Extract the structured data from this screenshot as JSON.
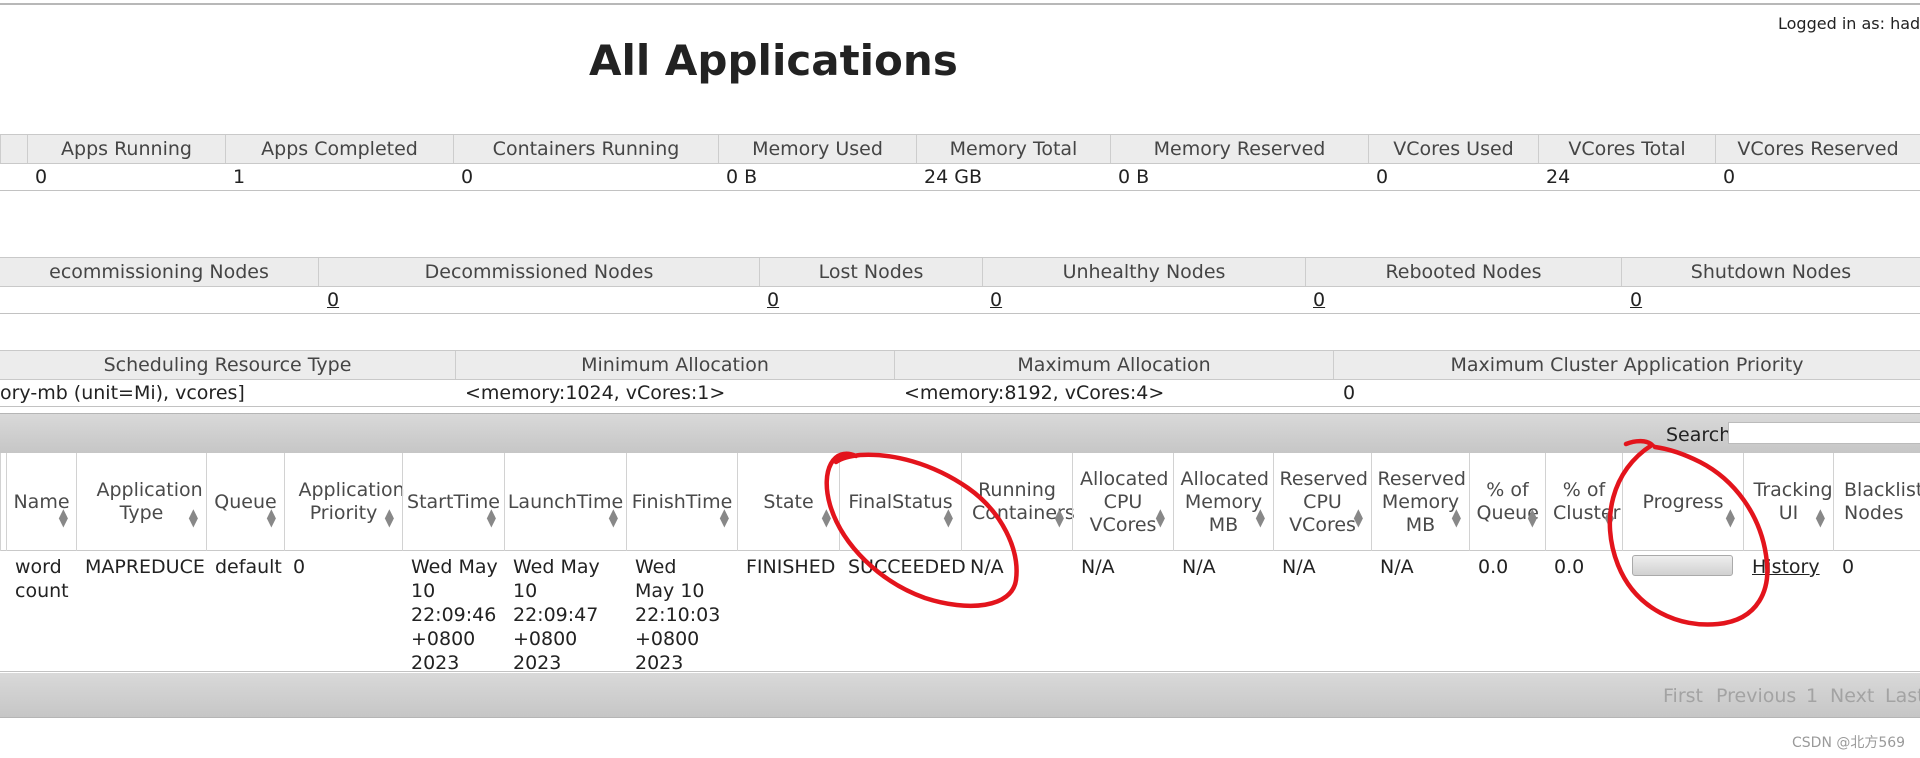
{
  "header": {
    "logged_in": "Logged in as: hadc",
    "title": "All Applications"
  },
  "metrics": {
    "headers": [
      "Apps Running",
      "Apps Completed",
      "Containers Running",
      "Memory Used",
      "Memory Total",
      "Memory Reserved",
      "VCores Used",
      "VCores Total",
      "VCores Reserved"
    ],
    "values": [
      "0",
      "1",
      "0",
      "0 B",
      "24 GB",
      "0 B",
      "0",
      "24",
      "0"
    ]
  },
  "nodes": {
    "headers": [
      "ecommissioning Nodes",
      "Decommissioned Nodes",
      "Lost Nodes",
      "Unhealthy Nodes",
      "Rebooted Nodes",
      "Shutdown Nodes"
    ],
    "values": [
      "0",
      "0",
      "0",
      "0",
      "0"
    ]
  },
  "scheduler": {
    "headers": [
      "Scheduling Resource Type",
      "Minimum Allocation",
      "Maximum Allocation",
      "Maximum Cluster Application Priority"
    ],
    "values": [
      "ory-mb (unit=Mi), vcores]",
      "<memory:1024, vCores:1>",
      "<memory:8192, vCores:4>",
      "0"
    ]
  },
  "search": {
    "label": "Search:",
    "value": ""
  },
  "apps_table": {
    "columns": [
      "Name",
      "Application Type",
      "Queue",
      "Application Priority",
      "StartTime",
      "LaunchTime",
      "FinishTime",
      "State",
      "FinalStatus",
      "Running Containers",
      "Allocated CPU VCores",
      "Allocated Memory MB",
      "Reserved CPU VCores",
      "Reserved Memory MB",
      "% of Queue",
      "% of Cluster",
      "Progress",
      "Tracking UI",
      "Blackliste Nodes"
    ],
    "row": {
      "name": "word count",
      "type": "MAPREDUCE",
      "queue": "default",
      "priority": "0",
      "start": "Wed May 10 22:09:46 +0800 2023",
      "launch": "Wed May 10 22:09:47 +0800 2023",
      "finish": "Wed May 10 22:10:03 +0800 2023",
      "state": "FINISHED",
      "final_status": "SUCCEEDED",
      "running_containers": "N/A",
      "alloc_cpu": "N/A",
      "alloc_mem": "N/A",
      "res_cpu": "N/A",
      "res_mem": "N/A",
      "pct_queue": "0.0",
      "pct_cluster": "0.0",
      "tracking": "History",
      "blacklisted": "0"
    }
  },
  "pagination": {
    "first": "First",
    "previous": "Previous",
    "page": "1",
    "next": "Next",
    "last": "Last"
  },
  "watermark": "CSDN @北方569",
  "colors": {
    "annotation_red": "#e3141c",
    "header_bg": "#ececec",
    "toolbar_bg": "#cfcfcf"
  }
}
